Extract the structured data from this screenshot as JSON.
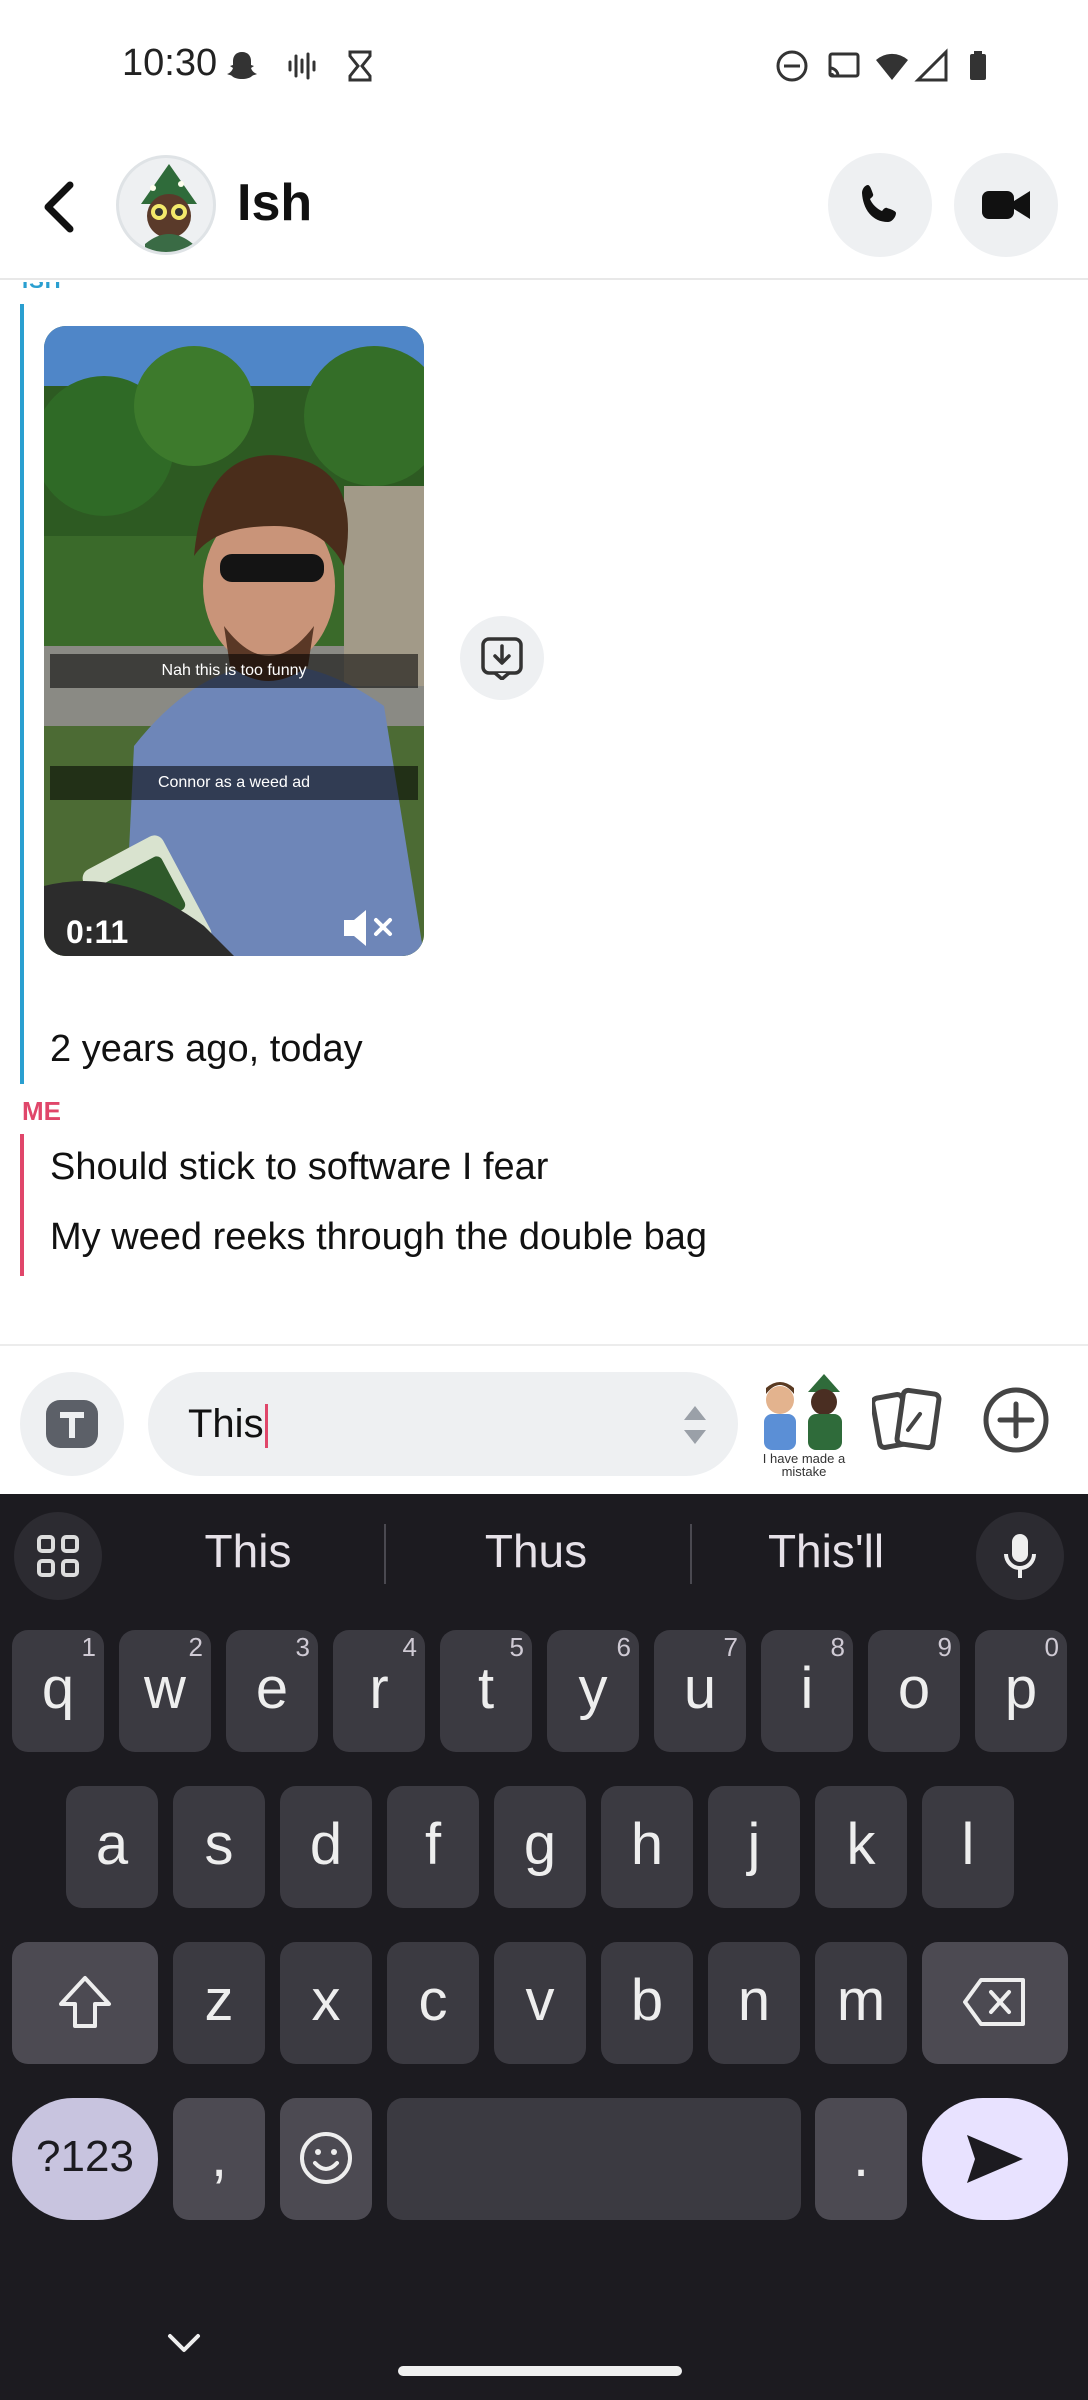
{
  "status_bar": {
    "time": "10:30"
  },
  "header": {
    "contact_name": "Ish"
  },
  "conversation": {
    "sender_ish": "ISH",
    "media": {
      "caption_top": "Nah this is too funny",
      "caption_bottom": "Connor as a weed ad",
      "duration": "0:11"
    },
    "ish_message": "2 years ago, today",
    "sender_me": "ME",
    "me_messages": [
      "Should stick to software I fear",
      "My weed reeks through the double bag"
    ]
  },
  "composer": {
    "input_value": "This",
    "sticker_caption": "I have made a mistake"
  },
  "keyboard": {
    "suggestions": [
      "This",
      "Thus",
      "This'll"
    ],
    "row1": [
      {
        "key": "q",
        "hint": "1"
      },
      {
        "key": "w",
        "hint": "2"
      },
      {
        "key": "e",
        "hint": "3"
      },
      {
        "key": "r",
        "hint": "4"
      },
      {
        "key": "t",
        "hint": "5"
      },
      {
        "key": "y",
        "hint": "6"
      },
      {
        "key": "u",
        "hint": "7"
      },
      {
        "key": "i",
        "hint": "8"
      },
      {
        "key": "o",
        "hint": "9"
      },
      {
        "key": "p",
        "hint": "0"
      }
    ],
    "row2": [
      "a",
      "s",
      "d",
      "f",
      "g",
      "h",
      "j",
      "k",
      "l"
    ],
    "row3": [
      "z",
      "x",
      "c",
      "v",
      "b",
      "n",
      "m"
    ],
    "symbols_label": "?123",
    "comma": ",",
    "period": "."
  },
  "colors": {
    "ish_accent": "#2a9fd0",
    "me_accent": "#e0466a",
    "keyboard_bg": "#1c1b20",
    "key_bg": "#3b3a41"
  }
}
